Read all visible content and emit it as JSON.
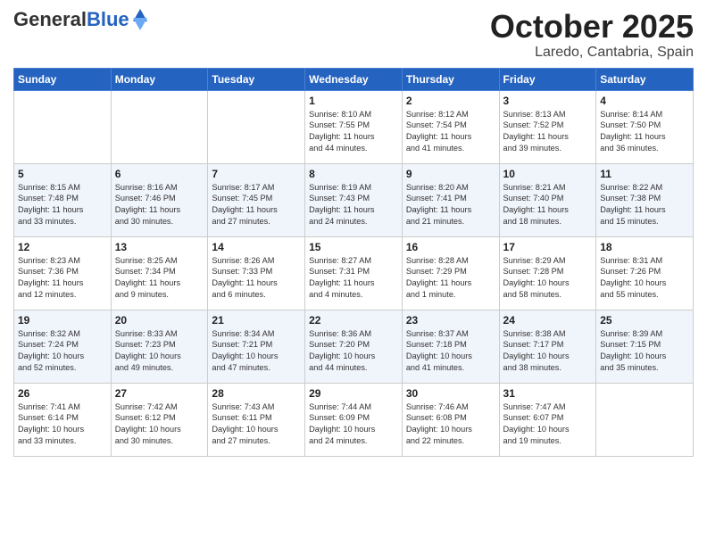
{
  "logo": {
    "general": "General",
    "blue": "Blue"
  },
  "header": {
    "month": "October 2025",
    "location": "Laredo, Cantabria, Spain"
  },
  "weekdays": [
    "Sunday",
    "Monday",
    "Tuesday",
    "Wednesday",
    "Thursday",
    "Friday",
    "Saturday"
  ],
  "weeks": [
    [
      {
        "day": "",
        "info": ""
      },
      {
        "day": "",
        "info": ""
      },
      {
        "day": "",
        "info": ""
      },
      {
        "day": "1",
        "info": "Sunrise: 8:10 AM\nSunset: 7:55 PM\nDaylight: 11 hours\nand 44 minutes."
      },
      {
        "day": "2",
        "info": "Sunrise: 8:12 AM\nSunset: 7:54 PM\nDaylight: 11 hours\nand 41 minutes."
      },
      {
        "day": "3",
        "info": "Sunrise: 8:13 AM\nSunset: 7:52 PM\nDaylight: 11 hours\nand 39 minutes."
      },
      {
        "day": "4",
        "info": "Sunrise: 8:14 AM\nSunset: 7:50 PM\nDaylight: 11 hours\nand 36 minutes."
      }
    ],
    [
      {
        "day": "5",
        "info": "Sunrise: 8:15 AM\nSunset: 7:48 PM\nDaylight: 11 hours\nand 33 minutes."
      },
      {
        "day": "6",
        "info": "Sunrise: 8:16 AM\nSunset: 7:46 PM\nDaylight: 11 hours\nand 30 minutes."
      },
      {
        "day": "7",
        "info": "Sunrise: 8:17 AM\nSunset: 7:45 PM\nDaylight: 11 hours\nand 27 minutes."
      },
      {
        "day": "8",
        "info": "Sunrise: 8:19 AM\nSunset: 7:43 PM\nDaylight: 11 hours\nand 24 minutes."
      },
      {
        "day": "9",
        "info": "Sunrise: 8:20 AM\nSunset: 7:41 PM\nDaylight: 11 hours\nand 21 minutes."
      },
      {
        "day": "10",
        "info": "Sunrise: 8:21 AM\nSunset: 7:40 PM\nDaylight: 11 hours\nand 18 minutes."
      },
      {
        "day": "11",
        "info": "Sunrise: 8:22 AM\nSunset: 7:38 PM\nDaylight: 11 hours\nand 15 minutes."
      }
    ],
    [
      {
        "day": "12",
        "info": "Sunrise: 8:23 AM\nSunset: 7:36 PM\nDaylight: 11 hours\nand 12 minutes."
      },
      {
        "day": "13",
        "info": "Sunrise: 8:25 AM\nSunset: 7:34 PM\nDaylight: 11 hours\nand 9 minutes."
      },
      {
        "day": "14",
        "info": "Sunrise: 8:26 AM\nSunset: 7:33 PM\nDaylight: 11 hours\nand 6 minutes."
      },
      {
        "day": "15",
        "info": "Sunrise: 8:27 AM\nSunset: 7:31 PM\nDaylight: 11 hours\nand 4 minutes."
      },
      {
        "day": "16",
        "info": "Sunrise: 8:28 AM\nSunset: 7:29 PM\nDaylight: 11 hours\nand 1 minute."
      },
      {
        "day": "17",
        "info": "Sunrise: 8:29 AM\nSunset: 7:28 PM\nDaylight: 10 hours\nand 58 minutes."
      },
      {
        "day": "18",
        "info": "Sunrise: 8:31 AM\nSunset: 7:26 PM\nDaylight: 10 hours\nand 55 minutes."
      }
    ],
    [
      {
        "day": "19",
        "info": "Sunrise: 8:32 AM\nSunset: 7:24 PM\nDaylight: 10 hours\nand 52 minutes."
      },
      {
        "day": "20",
        "info": "Sunrise: 8:33 AM\nSunset: 7:23 PM\nDaylight: 10 hours\nand 49 minutes."
      },
      {
        "day": "21",
        "info": "Sunrise: 8:34 AM\nSunset: 7:21 PM\nDaylight: 10 hours\nand 47 minutes."
      },
      {
        "day": "22",
        "info": "Sunrise: 8:36 AM\nSunset: 7:20 PM\nDaylight: 10 hours\nand 44 minutes."
      },
      {
        "day": "23",
        "info": "Sunrise: 8:37 AM\nSunset: 7:18 PM\nDaylight: 10 hours\nand 41 minutes."
      },
      {
        "day": "24",
        "info": "Sunrise: 8:38 AM\nSunset: 7:17 PM\nDaylight: 10 hours\nand 38 minutes."
      },
      {
        "day": "25",
        "info": "Sunrise: 8:39 AM\nSunset: 7:15 PM\nDaylight: 10 hours\nand 35 minutes."
      }
    ],
    [
      {
        "day": "26",
        "info": "Sunrise: 7:41 AM\nSunset: 6:14 PM\nDaylight: 10 hours\nand 33 minutes."
      },
      {
        "day": "27",
        "info": "Sunrise: 7:42 AM\nSunset: 6:12 PM\nDaylight: 10 hours\nand 30 minutes."
      },
      {
        "day": "28",
        "info": "Sunrise: 7:43 AM\nSunset: 6:11 PM\nDaylight: 10 hours\nand 27 minutes."
      },
      {
        "day": "29",
        "info": "Sunrise: 7:44 AM\nSunset: 6:09 PM\nDaylight: 10 hours\nand 24 minutes."
      },
      {
        "day": "30",
        "info": "Sunrise: 7:46 AM\nSunset: 6:08 PM\nDaylight: 10 hours\nand 22 minutes."
      },
      {
        "day": "31",
        "info": "Sunrise: 7:47 AM\nSunset: 6:07 PM\nDaylight: 10 hours\nand 19 minutes."
      },
      {
        "day": "",
        "info": ""
      }
    ]
  ]
}
